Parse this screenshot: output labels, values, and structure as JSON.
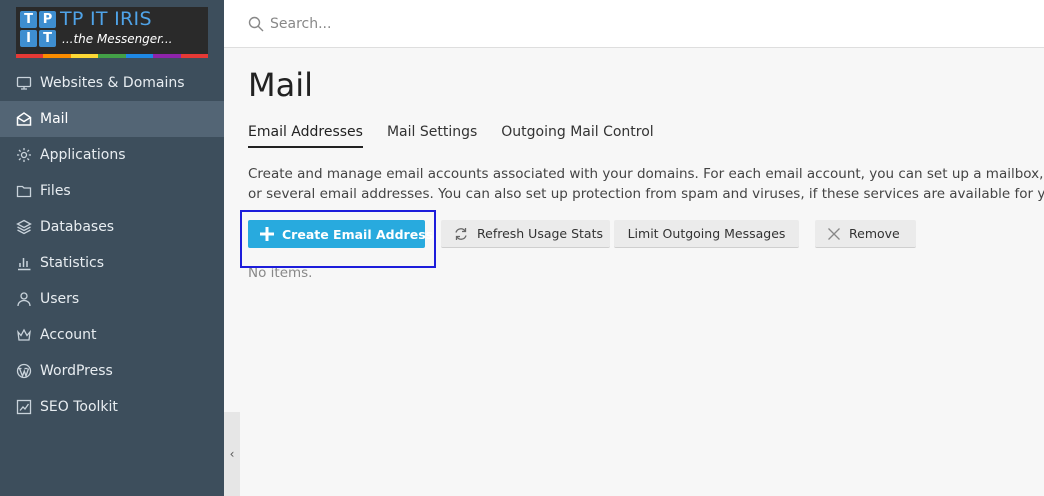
{
  "logo": {
    "letters": [
      "T",
      "P",
      "I",
      "T"
    ],
    "title": "TP IT IRIS",
    "subtitle": "...the Messenger...",
    "rainbow": [
      "#e53935",
      "#fb8c00",
      "#fdd835",
      "#43a047",
      "#1e88e5",
      "#8e24aa",
      "#e53935"
    ]
  },
  "sidebar": {
    "items": [
      {
        "label": "Websites & Domains",
        "icon": "monitor-icon"
      },
      {
        "label": "Mail",
        "icon": "mail-icon",
        "active": true
      },
      {
        "label": "Applications",
        "icon": "gear-icon"
      },
      {
        "label": "Files",
        "icon": "folder-icon"
      },
      {
        "label": "Databases",
        "icon": "layers-icon"
      },
      {
        "label": "Statistics",
        "icon": "bar-chart-icon"
      },
      {
        "label": "Users",
        "icon": "user-icon"
      },
      {
        "label": "Account",
        "icon": "crown-icon"
      },
      {
        "label": "WordPress",
        "icon": "wordpress-icon"
      },
      {
        "label": "SEO Toolkit",
        "icon": "seo-chart-icon"
      }
    ],
    "collapse_glyph": "‹"
  },
  "header": {
    "search_placeholder": "Search..."
  },
  "main": {
    "title": "Mail",
    "tabs": [
      {
        "label": "Email Addresses",
        "active": true
      },
      {
        "label": "Mail Settings"
      },
      {
        "label": "Outgoing Mail Control"
      }
    ],
    "description_line1": "Create and manage email accounts associated with your domains. For each email account, you can set up a mailbox, a number of email aliases, and forwarding to one",
    "description_line2": "or several email addresses. You can also set up protection from spam and viruses, if these services are available for your account.",
    "toolbar": {
      "create_label": "Create Email Address",
      "refresh_label": "Refresh Usage Stats",
      "limit_label": "Limit Outgoing Messages",
      "remove_label": "Remove"
    },
    "empty_text": "No items."
  },
  "colors": {
    "sidebar_bg": "#3d4e5c",
    "sidebar_active": "#536575",
    "primary_button": "#28aade",
    "highlight_border": "#1d1ddb"
  }
}
